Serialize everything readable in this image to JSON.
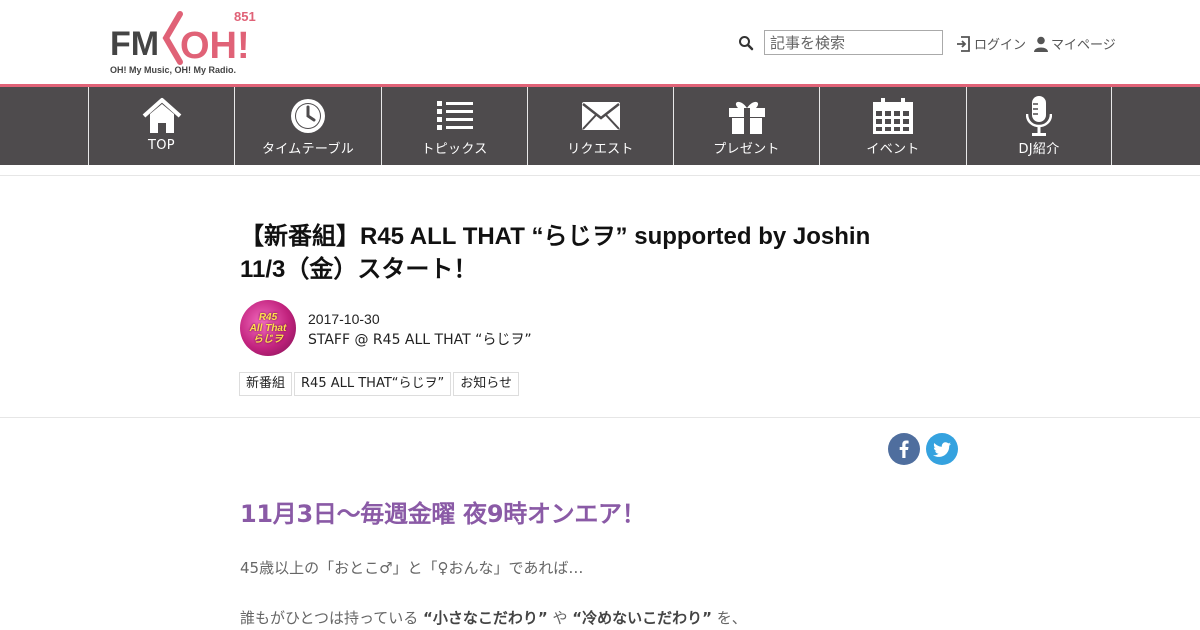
{
  "header": {
    "logo": {
      "brand": "FM OH!",
      "frequency": "851",
      "tagline": "OH! My Music,  OH! My Radio."
    },
    "search": {
      "placeholder": "記事を検索",
      "value": ""
    },
    "login_label": "ログイン",
    "mypage_label": "マイページ"
  },
  "nav": {
    "items": [
      {
        "label": "TOP",
        "icon": "home-icon"
      },
      {
        "label": "タイムテーブル",
        "icon": "clock-icon"
      },
      {
        "label": "トピックス",
        "icon": "list-icon"
      },
      {
        "label": "リクエスト",
        "icon": "envelope-icon"
      },
      {
        "label": "プレゼント",
        "icon": "gift-icon"
      },
      {
        "label": "イベント",
        "icon": "calendar-icon"
      },
      {
        "label": "DJ紹介",
        "icon": "microphone-icon"
      }
    ]
  },
  "article": {
    "title_line1": "【新番組】R45 ALL THAT “らじヲ” supported by Joshin",
    "title_line2": "11/3（金）スタート！",
    "date": "2017-10-30",
    "author": "STAFF @ R45 ALL THAT “らじヲ”",
    "avatar_text": [
      "R45",
      "All That",
      "らじヲ"
    ],
    "tags": [
      "新番組",
      "R45 ALL THAT“らじヲ”",
      "お知らせ"
    ],
    "share": [
      "facebook-icon",
      "twitter-icon"
    ],
    "heading": "11月3日～毎週金曜 夜9時オンエア！",
    "para1": "45歳以上の「おとこ♂」と「♀おんな」であれば…",
    "para2_pre": "誰もがひとつは持っている ",
    "para2_b1": "“小さなこだわり”",
    "para2_mid": " や ",
    "para2_b2": "“冷めないこだわり”",
    "para2_post": " を、"
  },
  "colors": {
    "accent": "#e06277",
    "nav_bg": "#4e4b4d",
    "heading": "#8a5aa6",
    "facebook": "#4f6e9e",
    "twitter": "#35a2df"
  }
}
